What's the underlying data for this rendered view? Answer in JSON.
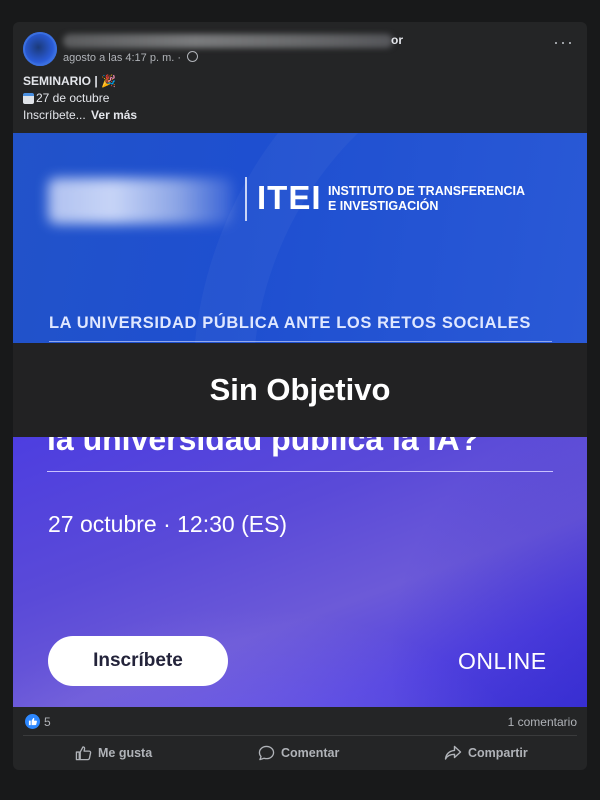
{
  "post": {
    "author_tail": "or",
    "meta_time": "agosto a las 4:17 p. m. ·",
    "line1": "SEMINARIO |",
    "line1_emoji": "🎉",
    "line2": "27 de octubre",
    "line3": "Inscríbete...",
    "see_more": "Ver más"
  },
  "banner": {
    "org_short": "ITEI",
    "org_line1": "INSTITUTO DE TRANSFERENCIA",
    "org_line2": "E INVESTIGACIÓN",
    "tagline": "LA UNIVERSIDAD PÚBLICA ANTE LOS RETOS SOCIALES",
    "cut_title": "la universidad pública la IA?",
    "date_time": "27 octubre · 12:30 (ES)",
    "cta": "Inscríbete",
    "mode": "ONLINE"
  },
  "overlay": {
    "label": "Sin Objetivo"
  },
  "footer": {
    "like_count": "5",
    "comments": "1 comentario",
    "like_label": "Me gusta",
    "comment_label": "Comentar",
    "share_label": "Compartir"
  },
  "colors": {
    "background": "#18191a",
    "card": "#242526",
    "banner_blue": "#2253c9",
    "banner_purple": "#5a4ad8",
    "like_blue": "#2d88ff"
  }
}
